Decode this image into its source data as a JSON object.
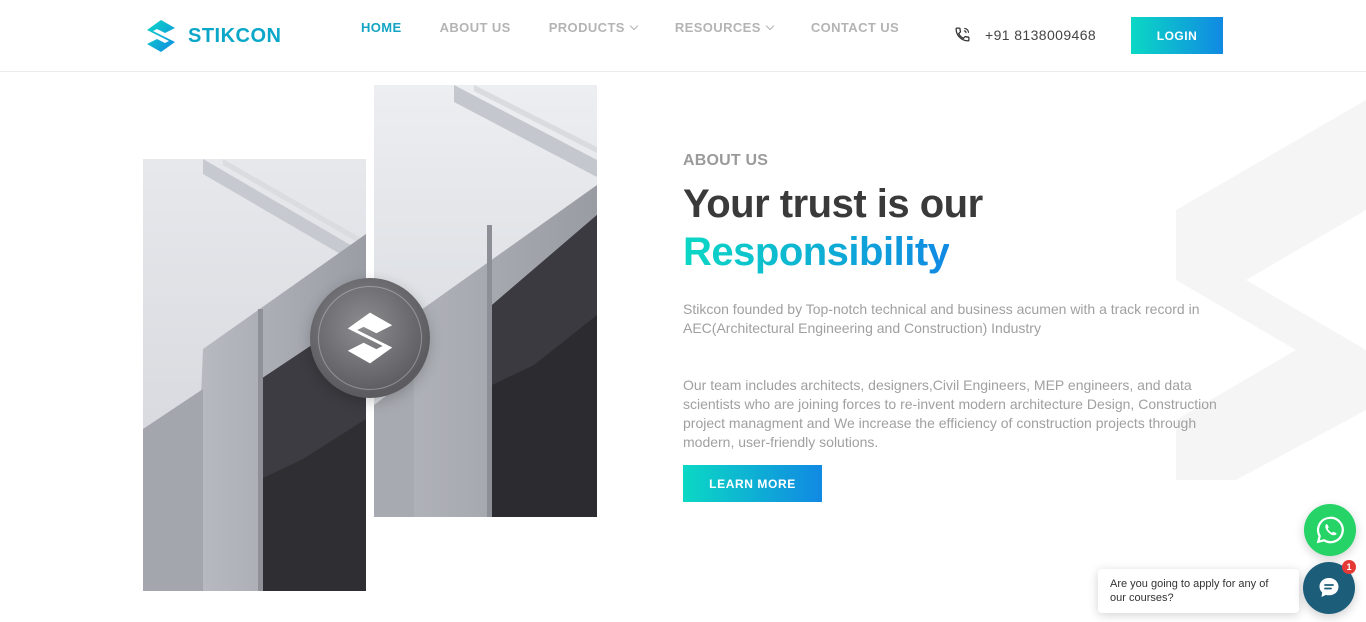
{
  "brand": {
    "name": "STIKCON",
    "accent": "#0aa7c9",
    "gradient_start": "#0bd8c4",
    "gradient_end": "#1189e3"
  },
  "nav": {
    "items": [
      {
        "label": "HOME",
        "active": true
      },
      {
        "label": "ABOUT US",
        "active": false
      },
      {
        "label": "PRODUCTS",
        "active": false,
        "dropdown": true
      },
      {
        "label": "RESOURCES",
        "active": false,
        "dropdown": true
      },
      {
        "label": "CONTACT US",
        "active": false
      }
    ]
  },
  "header": {
    "phone": "+91 8138009468",
    "phone_icon": "phone-icon",
    "login_label": "LOGIN"
  },
  "about": {
    "eyebrow": "ABOUT US",
    "headline": "Your trust is our",
    "headline_accent": "Responsibility",
    "paragraph1": "Stikcon founded by Top-notch technical and business acumen with a track record in AEC(Architectural Engineering and Construction) Industry",
    "paragraph2": "Our team includes architects, designers,Civil Engineers, MEP engineers, and data scientists who are joining forces to re-invent modern architecture Design, Construction project managment and We increase the efficiency of construction projects through modern, user-friendly solutions.",
    "cta_label": "LEARN MORE"
  },
  "widgets": {
    "whatsapp_icon": "whatsapp-icon",
    "whatsapp_color": "#25d366",
    "chat_message": "Are you going to apply for any of our courses?",
    "chat_badge_count": "1",
    "chat_color": "#1c5e7a"
  }
}
